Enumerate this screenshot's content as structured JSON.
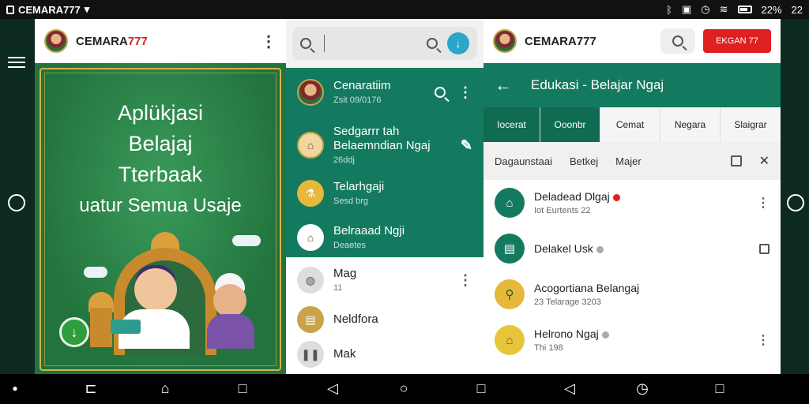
{
  "status_bar": {
    "carrier": "CEMARA777",
    "battery_percent": "22%",
    "time": "22"
  },
  "panel_home": {
    "brand_prefix": "CEMARA",
    "brand_suffix": "777",
    "banner_lines": [
      "Aplükjasi",
      "Belajaj",
      "Tterbaak",
      "uatur Semua Usaje"
    ]
  },
  "panel_chats": {
    "search_placeholder": "",
    "green_items": [
      {
        "title": "Cenaratiim",
        "sub": "Zsit 09/0176"
      },
      {
        "title": "Sedgarrr tah",
        "title2": "Belaemndian Ngaj",
        "sub": "26ddj"
      },
      {
        "title": "Telarhgaji",
        "sub": "Sesd brg"
      },
      {
        "title": "Belraaad Ngji",
        "sub": "Deaetes"
      }
    ],
    "white_items": [
      {
        "title": "Mag",
        "sub": "11"
      },
      {
        "title": "Neldfora",
        "sub": ""
      },
      {
        "title": "Mak",
        "sub": ""
      }
    ]
  },
  "panel_edu": {
    "brand": "CEMARA777",
    "red_button": "EKGAN 77",
    "title": "Edukasi - Belajar Ngaj",
    "tabs": [
      "Iocerat",
      "Ooonbr",
      "Cemat",
      "Negara",
      "Slaigrar"
    ],
    "filters": [
      "Dagaunstaai",
      "Betkej",
      "Majer"
    ],
    "items": [
      {
        "title": "Deladead Dlgaj",
        "sub": "Iot Eurtents 22",
        "badge": "red"
      },
      {
        "title": "Delakel Usk",
        "sub": "",
        "badge": "grey"
      },
      {
        "title": "Acogortiana Belangaj",
        "sub": "23 Telarage 3203",
        "badge": ""
      },
      {
        "title": "Helrono Ngaj",
        "sub": "Thi 198",
        "badge": "grey"
      }
    ]
  }
}
